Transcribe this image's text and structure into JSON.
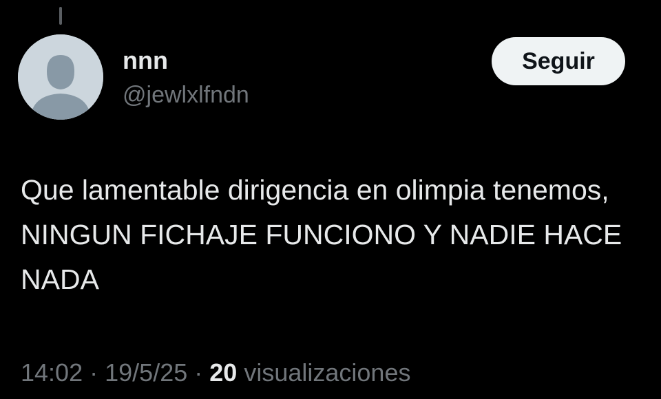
{
  "author": {
    "display_name": "nnn",
    "handle": "@jewlxlfndn",
    "avatar": "default-avatar-icon"
  },
  "follow_button": {
    "label": "Seguir"
  },
  "tweet": {
    "text": "Que lamentable dirigencia en olimpia tenemos, NINGUN FICHAJE FUNCIONO Y NADIE HACE NADA"
  },
  "meta": {
    "time": "14:02",
    "separator": "·",
    "date": "19/5/25",
    "views_count": "20",
    "views_label": "visualizaciones"
  },
  "colors": {
    "background": "#000000",
    "primary_text": "#e7e9ea",
    "secondary_text": "#71767b",
    "button_bg": "#eff3f4",
    "button_text": "#0f1419",
    "avatar_bg": "#ccd6dd",
    "avatar_fg": "#8899a6"
  }
}
